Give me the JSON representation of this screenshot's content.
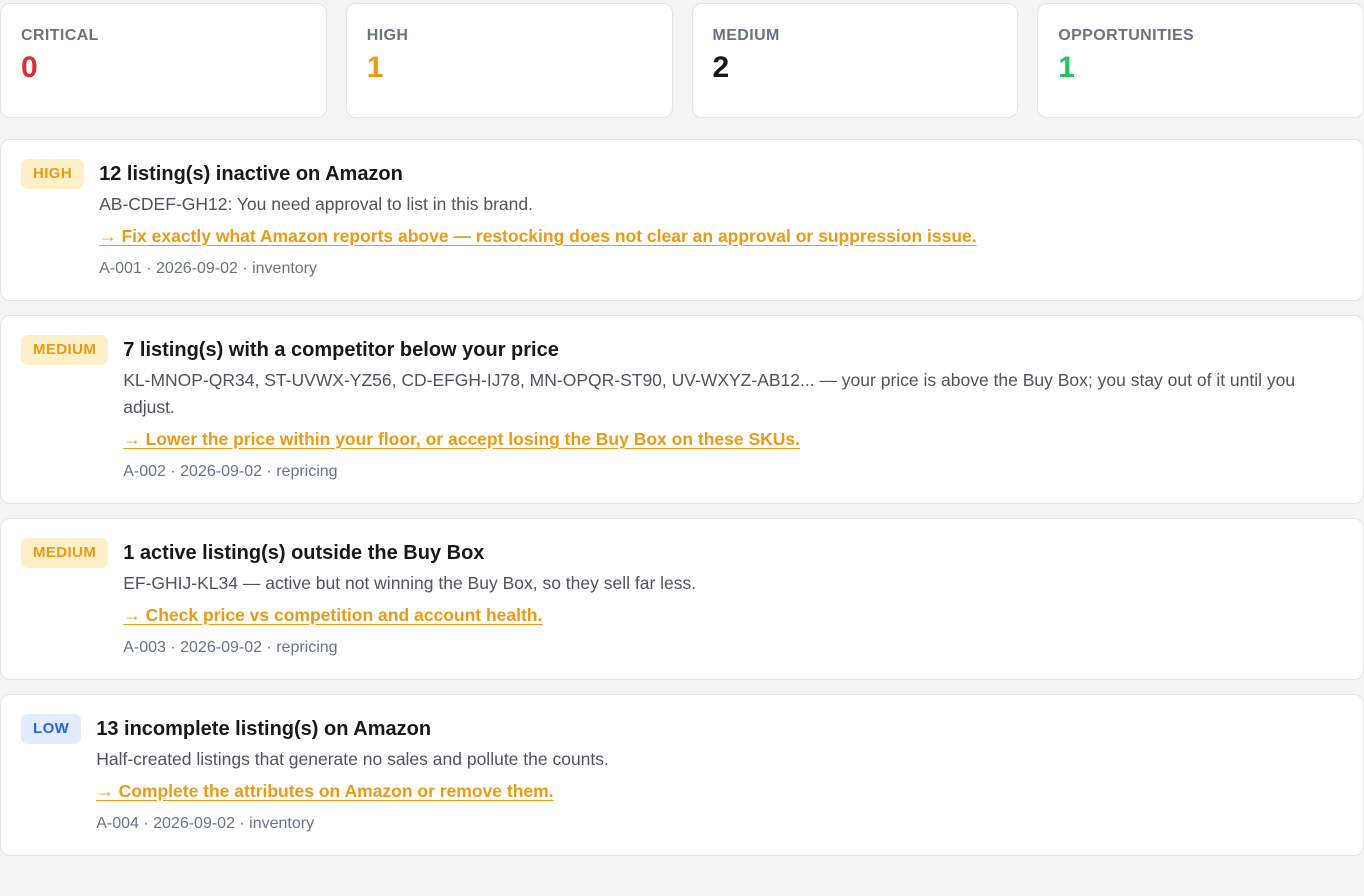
{
  "summary": [
    {
      "label": "CRITICAL",
      "value": "0",
      "color": "#dc2f2f"
    },
    {
      "label": "HIGH",
      "value": "1",
      "color": "#ea9a14"
    },
    {
      "label": "MEDIUM",
      "value": "2",
      "color": "#18181b"
    },
    {
      "label": "OPPORTUNITIES",
      "value": "1",
      "color": "#22c55e"
    }
  ],
  "alerts": [
    {
      "severity": "HIGH",
      "severity_class": "high",
      "title": "12 listing(s) inactive on Amazon",
      "description": "AB-CDEF-GH12: You need approval to list in this brand.",
      "action": "→ Fix exactly what Amazon reports above — restocking does not clear an approval or suppression issue.",
      "meta": "A-001 · 2026-09-02 · inventory"
    },
    {
      "severity": "MEDIUM",
      "severity_class": "medium",
      "title": "7 listing(s) with a competitor below your price",
      "description": "KL-MNOP-QR34, ST-UVWX-YZ56, CD-EFGH-IJ78, MN-OPQR-ST90, UV-WXYZ-AB12... — your price is above the Buy Box; you stay out of it until you adjust.",
      "action": "→ Lower the price within your floor, or accept losing the Buy Box on these SKUs.",
      "meta": "A-002 · 2026-09-02 · repricing"
    },
    {
      "severity": "MEDIUM",
      "severity_class": "medium",
      "title": "1 active listing(s) outside the Buy Box",
      "description": "EF-GHIJ-KL34 — active but not winning the Buy Box, so they sell far less.",
      "action": "→ Check price vs competition and account health.",
      "meta": "A-003 · 2026-09-02 · repricing"
    },
    {
      "severity": "LOW",
      "severity_class": "low",
      "title": "13 incomplete listing(s) on Amazon",
      "description": "Half-created listings that generate no sales and pollute the counts.",
      "action": "→ Complete the attributes on Amazon or remove them.",
      "meta": "A-004 · 2026-09-02 · inventory"
    }
  ]
}
